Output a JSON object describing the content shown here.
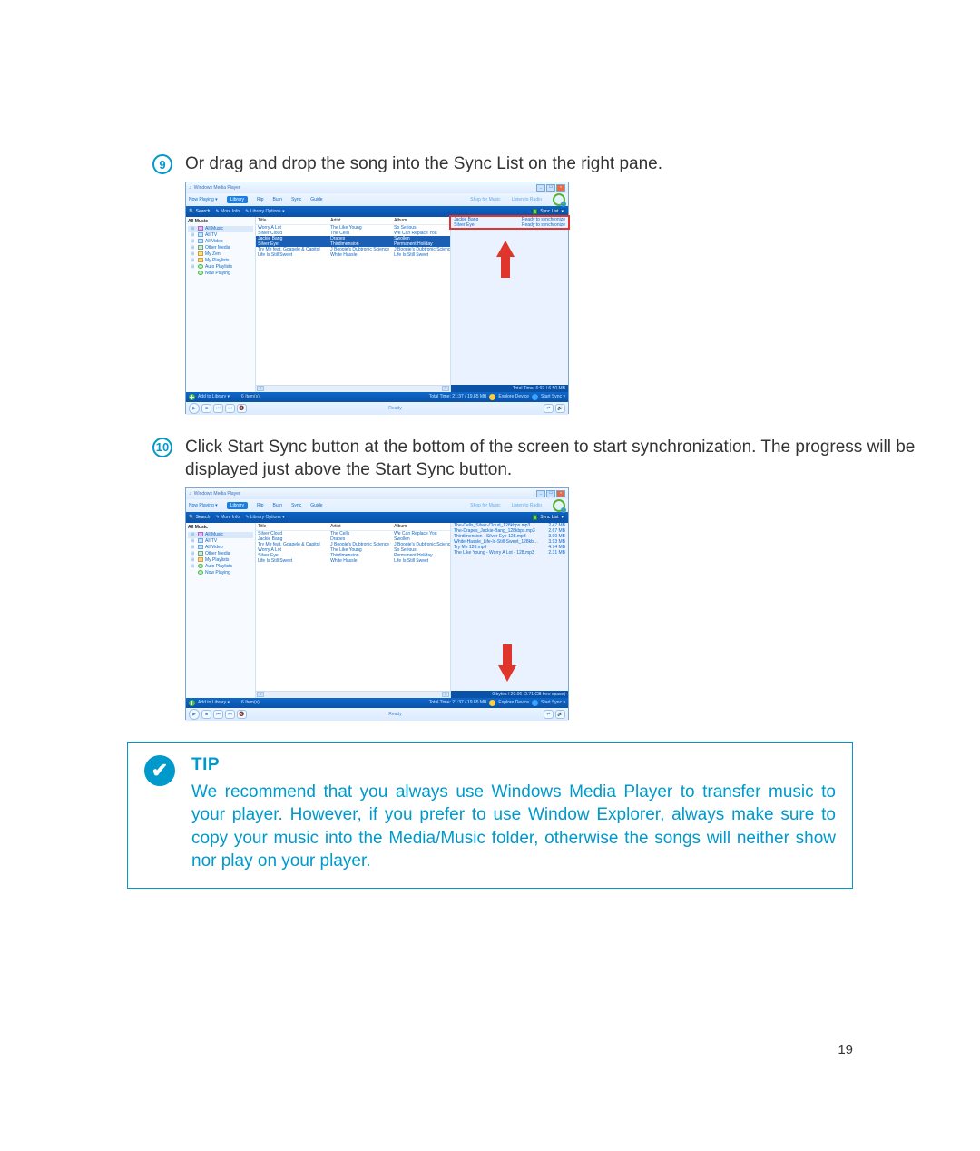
{
  "page_number": "19",
  "steps": {
    "s9": {
      "num": "9",
      "text": "Or drag and drop the song into the Sync List on the right pane."
    },
    "s10": {
      "num": "10",
      "text": "Click Start Sync button at the bottom of the screen to start synchronization. The progress will be displayed just above the Start Sync button."
    }
  },
  "tip": {
    "title": "TIP",
    "body": "We recommend that you always use Windows Media Player to transfer music to your player. However, if you prefer to use Window Explorer, always make sure to copy your music into the Media/Music folder, otherwise the songs will neither show nor play on your player."
  },
  "wmp": {
    "title": "Windows Media Player",
    "menu": {
      "now_playing": "Now Playing",
      "library": "Library",
      "rip": "Rip",
      "burn": "Burn",
      "sync": "Sync",
      "guide": "Guide",
      "shop_music": "Shop for Music",
      "listen_radio": "Listen to Radio"
    },
    "toolbar": {
      "search": "Search",
      "more_info": "More Info",
      "library_options": "Library Options",
      "sync_list": "Sync List"
    },
    "sidebar": {
      "header": "All Music",
      "items": [
        {
          "label": "All Music",
          "icon": "note",
          "sel": true
        },
        {
          "label": "All TV",
          "icon": "video"
        },
        {
          "label": "All Video",
          "icon": "video"
        },
        {
          "label": "Other Media",
          "icon": "media"
        },
        {
          "label": "My Zen",
          "icon": "zen"
        },
        {
          "label": "My Playlists",
          "icon": "folder"
        },
        {
          "label": "Auto Playlists",
          "icon": "play"
        },
        {
          "label": "Now Playing",
          "icon": "play"
        }
      ]
    },
    "columns": {
      "title": "Title",
      "artist": "Artist",
      "album": "Album"
    },
    "library_rows_a": [
      {
        "title": "Worry A Lot",
        "artist": "The Like Young",
        "album": "So Serious"
      },
      {
        "title": "Silver Cloud",
        "artist": "The Cells",
        "album": "We Can Replace You"
      },
      {
        "title": "Jackie Bang",
        "artist": "Drapes",
        "album": "Swollen",
        "sel": true
      },
      {
        "title": "Silver Eye",
        "artist": "Thirdimension",
        "album": "Permanent Holiday",
        "sel": true
      },
      {
        "title": "Try Me feat. Goapele & Capitol",
        "artist": "J Boogie's Dubtronic Science",
        "album": "J Boogie's Dubtronic Scienc"
      },
      {
        "title": "Life Is Still Sweet",
        "artist": "White Hassle",
        "album": "Life Is Still Sweet"
      }
    ],
    "library_rows_b": [
      {
        "title": "Silver Cloud",
        "artist": "The Cells",
        "album": "We Can Replace You"
      },
      {
        "title": "Jackie Bang",
        "artist": "Drapes",
        "album": "Swollen"
      },
      {
        "title": "Try Me feat. Goapele & Capitol",
        "artist": "J Boogie's Dubtronic Science",
        "album": "J Boogie's Dubtronic Scienc"
      },
      {
        "title": "Worry A Lot",
        "artist": "The Like Young",
        "album": "So Serious"
      },
      {
        "title": "Silver Eye",
        "artist": "Thirdimension",
        "album": "Permanent Holiday"
      },
      {
        "title": "Life Is Still Sweet",
        "artist": "White Hassle",
        "album": "Life Is Still Sweet"
      }
    ],
    "sync_rows_a": [
      {
        "name": "Jackie Bang",
        "status": "Ready to synchronize"
      },
      {
        "name": "Silver Eye",
        "status": "Ready to synchronize"
      }
    ],
    "sync_rows_b": [
      {
        "name": "The-Cells_Silver-Cloud_128kbps.mp3",
        "size": "2.47 MB"
      },
      {
        "name": "The-Drapes_Jackie-Bang_128kbps.mp3",
        "size": "2.67 MB"
      },
      {
        "name": "Thirdimension - Silver Eye-128.mp3",
        "size": "3.90 MB"
      },
      {
        "name": "White-Hassle_Life-Is-Still-Sweet_128kbps.mp3",
        "size": "3.93 MB"
      },
      {
        "name": "Try Me 128.mp3",
        "size": "4.74 MB"
      },
      {
        "name": "The Like Young - Worry A Lot - 128.mp3",
        "size": "2.31 MB"
      }
    ],
    "sync_footer_a": "Total Time: 6:97 / 6.50 MB",
    "sync_footer_b": "0 bytes / 20.06 (2.71 GB free space)",
    "bottom": {
      "add": "Add to Library",
      "items": "6 Item(s)",
      "total": "Total Time: 21:37 / 19.85 MB",
      "explore": "Explore Device",
      "start_sync": "Start Sync"
    },
    "status": "Ready"
  }
}
